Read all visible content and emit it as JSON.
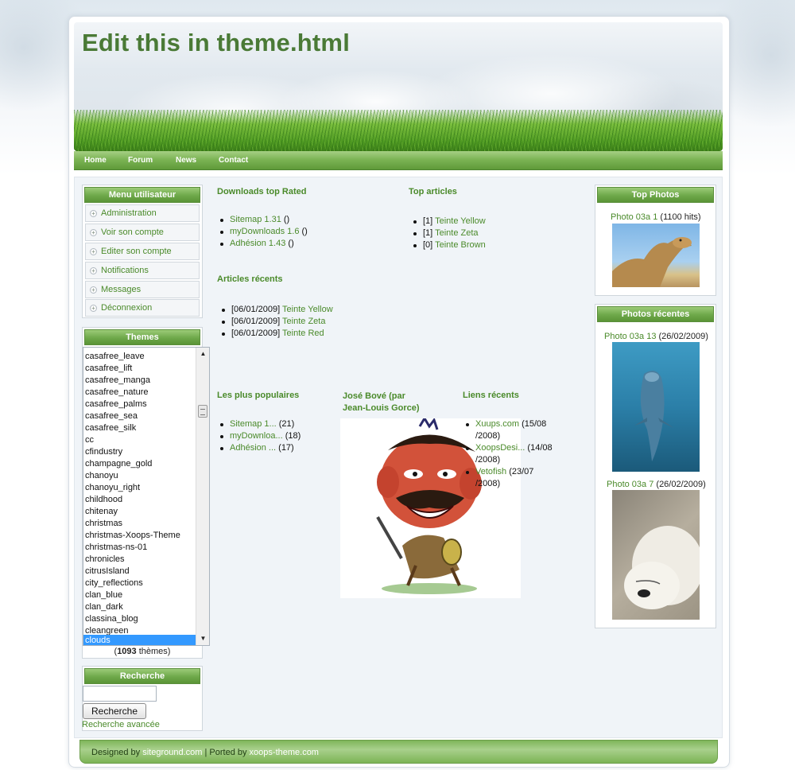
{
  "site": {
    "title": "Edit this in theme.html"
  },
  "nav": {
    "items": [
      "Home",
      "Forum",
      "News",
      "Contact"
    ]
  },
  "user_menu": {
    "title": "Menu utilisateur",
    "items": [
      "Administration",
      "Voir son compte",
      "Editer son compte",
      "Notifications",
      "Messages",
      "Déconnexion"
    ]
  },
  "themes": {
    "title": "Themes",
    "options": [
      "casafree_leave",
      "casafree_lift",
      "casafree_manga",
      "casafree_nature",
      "casafree_palms",
      "casafree_sea",
      "casafree_silk",
      "cc",
      "cfindustry",
      "champagne_gold",
      "chanoyu",
      "chanoyu_right",
      "childhood",
      "chitenay",
      "christmas",
      "christmas-Xoops-Theme",
      "christmas-ns-01",
      "chronicles",
      "citrusIsland",
      "city_reflections",
      "clan_blue",
      "clan_dark",
      "classina_blog",
      "cleangreen",
      "clouds"
    ],
    "selected": "clouds",
    "count_prefix": "(",
    "count": "1093",
    "count_suffix": " thèmes)"
  },
  "search": {
    "title": "Recherche",
    "button": "Recherche",
    "advanced": "Recherche avancée",
    "value": ""
  },
  "downloads_top_rated": {
    "title": "Downloads top Rated",
    "items": [
      {
        "link": "Sitemap 1.31",
        "suffix": " ()"
      },
      {
        "link": "myDownloads 1.6",
        "suffix": " ()"
      },
      {
        "link": "Adhésion 1.43",
        "suffix": " ()"
      }
    ]
  },
  "top_articles": {
    "title": "Top articles",
    "items": [
      {
        "prefix": "[1] ",
        "link": "Teinte Yellow"
      },
      {
        "prefix": "[1] ",
        "link": "Teinte Zeta"
      },
      {
        "prefix": "[0] ",
        "link": "Teinte Brown"
      }
    ]
  },
  "recent_articles": {
    "title": "Articles récents",
    "items": [
      {
        "prefix": "[06/01/2009] ",
        "link": "Teinte Yellow"
      },
      {
        "prefix": "[06/01/2009] ",
        "link": "Teinte Zeta"
      },
      {
        "prefix": "[06/01/2009] ",
        "link": "Teinte Red"
      }
    ]
  },
  "popular": {
    "title": "Les plus populaires",
    "items": [
      {
        "link": "Sitemap 1...",
        "suffix": " (21)"
      },
      {
        "link": "myDownloa...",
        "suffix": " (18)"
      },
      {
        "link": "Adhésion ...",
        "suffix": " (17)"
      }
    ]
  },
  "jose_bove": {
    "title_line1": "José Bové (par",
    "title_line2": "Jean-Louis Gorce)"
  },
  "recent_links": {
    "title": "Liens récents",
    "items": [
      {
        "link": "Xuups.com",
        "line1": " (15/08",
        "line2": "/2008)"
      },
      {
        "link": "XoopsDesi...",
        "line1": " (14/08",
        "line2": "/2008)"
      },
      {
        "link": "Vetofish",
        "line1": " (23/07",
        "line2": "/2008)"
      }
    ]
  },
  "top_photos": {
    "title": "Top Photos",
    "photo": {
      "link": "Photo 03a 1",
      "suffix": " (1100 hits)",
      "subject": "camel"
    }
  },
  "recent_photos": {
    "title": "Photos récentes",
    "photos": [
      {
        "link": "Photo 03a 13",
        "suffix": " (26/02/2009)",
        "subject": "dolphin"
      },
      {
        "link": "Photo 03a 7",
        "suffix": " (26/02/2009)",
        "subject": "polar-bear"
      }
    ]
  },
  "footer": {
    "designed_by": "Designed by ",
    "designer": "siteground.com",
    "sep": " | Ported by ",
    "porter": "xoops-theme.com"
  },
  "colors": {
    "accent_green": "#4a8a2a",
    "nav_green": "#6ea84a",
    "selection_blue": "#3399ff"
  }
}
